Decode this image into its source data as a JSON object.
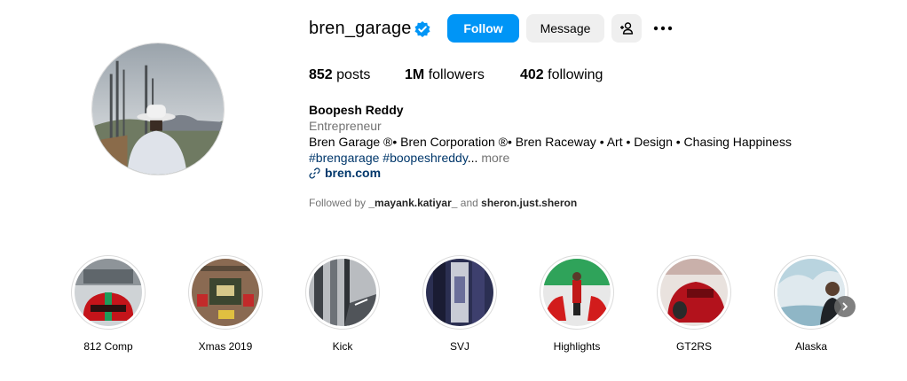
{
  "profile": {
    "username": "bren_garage",
    "follow_label": "Follow",
    "message_label": "Message",
    "stats": {
      "posts_count": "852",
      "posts_label": "posts",
      "followers_count": "1M",
      "followers_label": "followers",
      "following_count": "402",
      "following_label": "following"
    },
    "bio": {
      "name": "Boopesh Reddy",
      "category": "Entrepreneur",
      "line": "Bren Garage ®• Bren Corporation ®• Bren Raceway • Art • Design • Chasing Happiness",
      "tags": "#brengarage #boopeshreddy",
      "ellipsis": "...",
      "more": "more",
      "link": "bren.com"
    },
    "followed_by": {
      "prefix": "Followed by",
      "user1": "_mayank.katiyar_",
      "and": "and",
      "user2": "sheron.just.sheron"
    }
  },
  "highlights": [
    {
      "label": "812 Comp"
    },
    {
      "label": "Xmas 2019"
    },
    {
      "label": "Kick"
    },
    {
      "label": "SVJ"
    },
    {
      "label": "Highlights"
    },
    {
      "label": "GT2RS"
    },
    {
      "label": "Alaska"
    }
  ],
  "colors": {
    "follow_button": "#0095f6",
    "secondary_button": "#efefef",
    "link": "#00376b",
    "muted": "#737373"
  },
  "icons": {
    "verified": "verified-badge-icon",
    "add_user": "add-user-icon",
    "more": "more-options-icon",
    "link": "link-icon",
    "next": "chevron-right-icon"
  }
}
